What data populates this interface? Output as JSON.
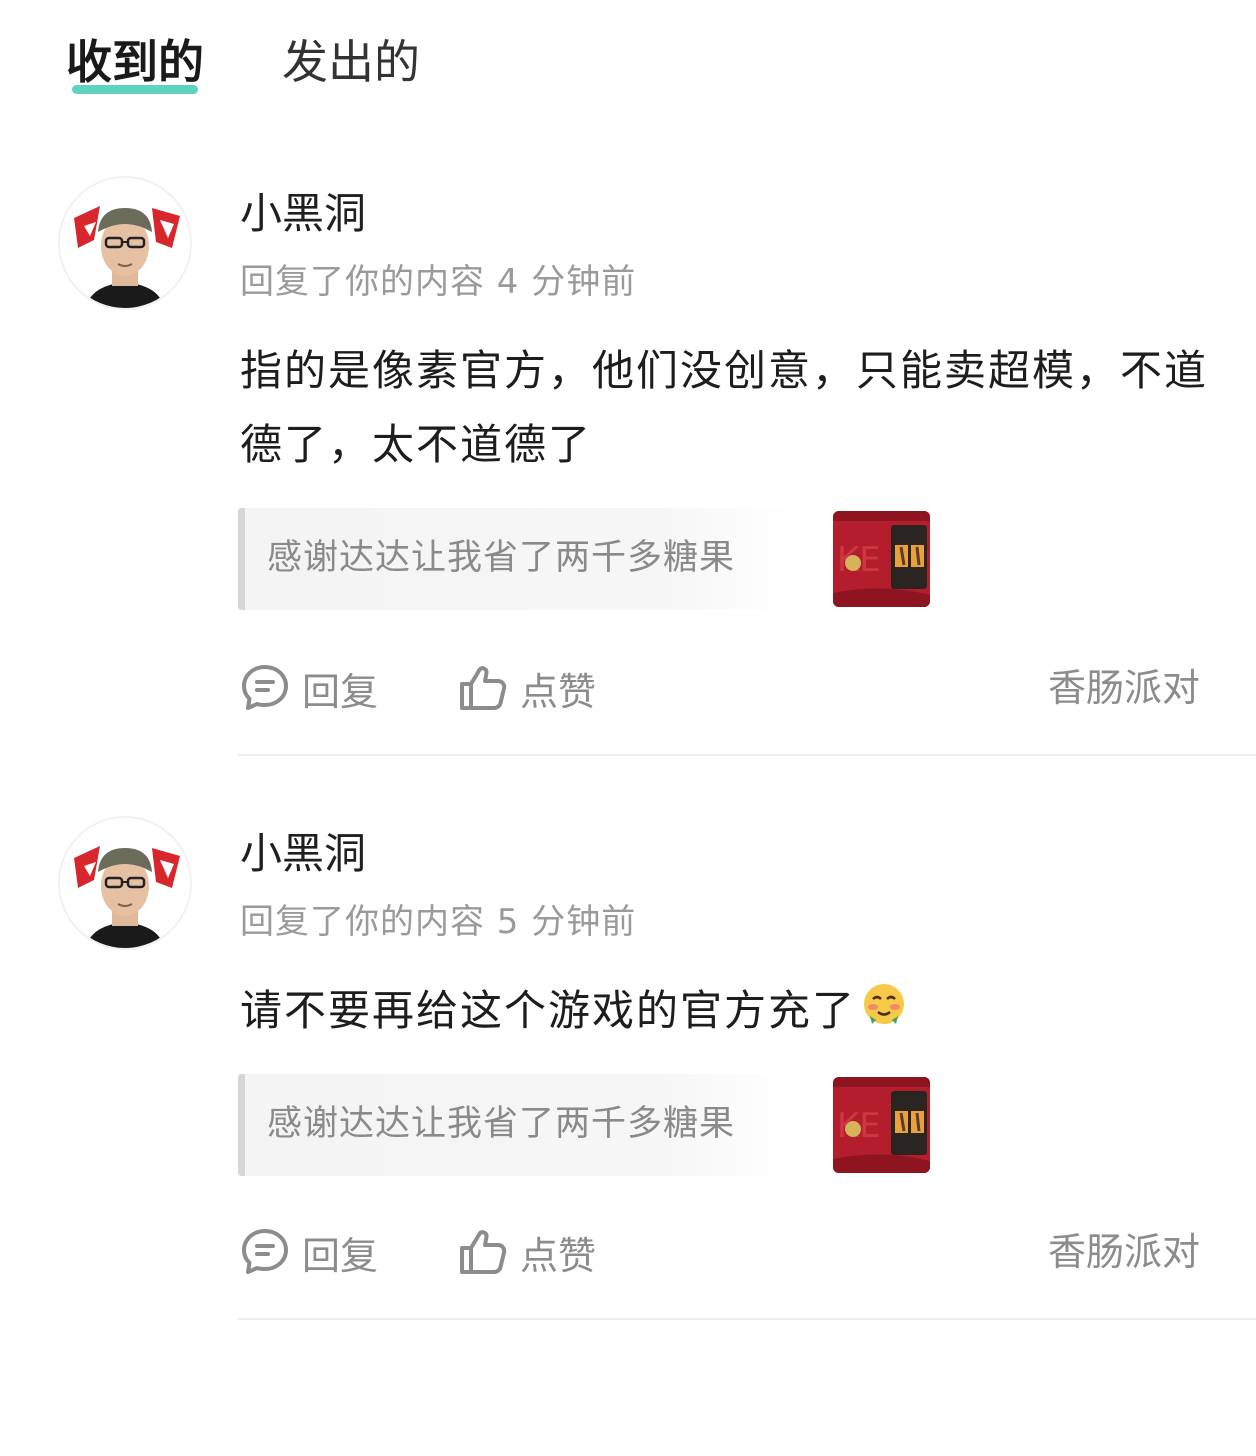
{
  "tabs": {
    "received": "收到的",
    "sent": "发出的"
  },
  "items": [
    {
      "user_name": "小黑洞",
      "meta": "回复了你的内容 4 分钟前",
      "content": "指的是像素官方，他们没创意，只能卖超模，不道德了，太不道德了",
      "quote_text": "感谢达达让我省了两千多糖果",
      "reply_label": "回复",
      "like_label": "点赞",
      "game_tag": "香肠派对"
    },
    {
      "user_name": "小黑洞",
      "meta": "回复了你的内容 5 分钟前",
      "content": "请不要再给这个游戏的官方充了",
      "quote_text": "感谢达达让我省了两千多糖果",
      "reply_label": "回复",
      "like_label": "点赞",
      "game_tag": "香肠派对"
    }
  ],
  "colors": {
    "tab_accent": "#5fd3c0",
    "secondary_text": "#9a9a9a"
  },
  "icons": {
    "reply": "chat-bubble-icon",
    "like": "thumbs-up-icon",
    "emoji": "blushing-face-emoji"
  }
}
